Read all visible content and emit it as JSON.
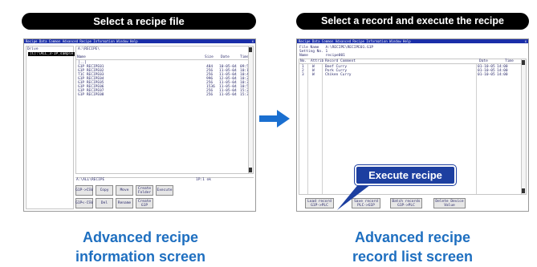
{
  "left_panel": {
    "header": "Select a recipe file",
    "caption_line1": "Advanced recipe",
    "caption_line2": "information screen",
    "screen": {
      "menu": "Recipe  Data  Common  Advanced Recipe  Information  Window  Help",
      "close": "x",
      "tree_label": "Drive",
      "tree_selected": "[C]:\\ALL_3-1P_sample",
      "path": "A:\\RECIPE\\",
      "columns": [
        "Name",
        "Size",
        "Date",
        "Time"
      ],
      "files": [
        {
          "name": "[..]",
          "size": "",
          "date": "",
          "time": ""
        },
        {
          "name": "G1P RECIPE01",
          "size": "484",
          "date": "10-05-04",
          "time": "09:54"
        },
        {
          "name": "G1P RECIPE02",
          "size": "256",
          "date": "11-05-04",
          "time": "10:15"
        },
        {
          "name": "T1C RECIPE03",
          "size": "256",
          "date": "11-05-04",
          "time": "10:40"
        },
        {
          "name": "G1P RECIPE04",
          "size": "996",
          "date": "12-05-04",
          "time": "10:28"
        },
        {
          "name": "G1P RECIPE05",
          "size": "256",
          "date": "11-05-04",
          "time": "10:35"
        },
        {
          "name": "G1P RECIPE06",
          "size": "1536",
          "date": "11-05-04",
          "time": "10:51"
        },
        {
          "name": "G1P RECIPE07",
          "size": "256",
          "date": "11-05-04",
          "time": "15:22"
        },
        {
          "name": "G1P RECIPE08",
          "size": "256",
          "date": "11-05-04",
          "time": "15:37"
        }
      ],
      "status_left": "A:\\ALL\\RECIPE",
      "status_right": "1P:1 ok",
      "buttons": {
        "g1p_csv": "G1P->CSV",
        "csv_g1p": "G1P<-CSV",
        "copy": "Copy",
        "del": "Del",
        "move": "Move",
        "rename": "Rename",
        "create_folder": "Create\nFolder",
        "create_g1p": "Create\nG1P",
        "execute": "Execute"
      }
    }
  },
  "right_panel": {
    "header": "Select a record and execute the recipe",
    "caption_line1": "Advanced recipe",
    "caption_line2": "record list screen",
    "callout": "Execute recipe",
    "screen": {
      "menu": "Recipe  Data  Common  Advanced Recipe  Information  Window  Help",
      "close": "x",
      "meta_lines": [
        "File Name   A:\\RECIPE\\RECIPE01.G1P",
        "Setting No. 1",
        "Name        recipe001"
      ],
      "columns": [
        "No.",
        "Attrib",
        "Record Comment",
        "Date",
        "Time"
      ],
      "records": [
        {
          "no": "1",
          "attrib": "W",
          "comment": "Beef Curry",
          "date": "01-10-05",
          "time": "14:00"
        },
        {
          "no": "2",
          "attrib": "W",
          "comment": "Pork Curry",
          "date": "01-10-05",
          "time": "14:00"
        },
        {
          "no": "3",
          "attrib": "W",
          "comment": "Chiken Curry",
          "date": "01-10-05",
          "time": "14:00"
        }
      ],
      "buttons": {
        "load_record": "Load record\nG1P->PLC",
        "save_record": "Save record\nPLC->G1P",
        "batch_records": "Batch records\nG1P->PLC",
        "delete_device": "Delete Device\nValue"
      }
    }
  },
  "colors": {
    "header_bg": "#000000",
    "caption_text": "#1e6fc0",
    "arrow": "#1a6fd0",
    "callout_bg": "#1d3fa0",
    "titlebar": "#1a2ea8"
  },
  "icons": {
    "arrow": "right-arrow-icon"
  }
}
